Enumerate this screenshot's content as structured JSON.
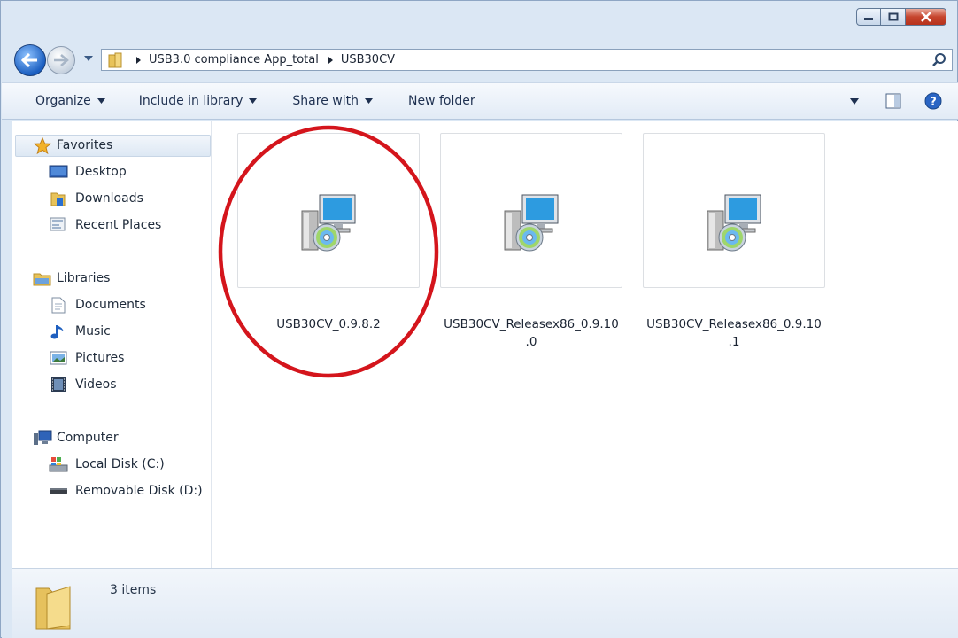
{
  "window": {
    "accent": "#1b5fc1",
    "address_path": [
      "USB3.0 compliance App_total",
      "USB30CV"
    ]
  },
  "caption_buttons": [
    "minimize-icon",
    "maximize-icon",
    "close-icon"
  ],
  "toolbar": {
    "organize": "Organize",
    "include_in_library": "Include in library",
    "share_with": "Share with",
    "new_folder": "New folder"
  },
  "nav": {
    "favorites": {
      "label": "Favorites",
      "items": [
        "Desktop",
        "Downloads",
        "Recent Places"
      ]
    },
    "libraries": {
      "label": "Libraries",
      "items": [
        "Documents",
        "Music",
        "Pictures",
        "Videos"
      ]
    },
    "computer": {
      "label": "Computer",
      "items": [
        "Local Disk (C:)",
        "Removable Disk (D:)"
      ]
    }
  },
  "files": [
    {
      "line1": "USB30CV_0.9.8.2",
      "line2": ""
    },
    {
      "line1": "USB30CV_Releasex86_0.9.10",
      "line2": ".0"
    },
    {
      "line1": "USB30CV_Releasex86_0.9.10",
      "line2": ".1"
    }
  ],
  "annotation_color": "#d4151c",
  "status": {
    "item_count": "3 items"
  }
}
